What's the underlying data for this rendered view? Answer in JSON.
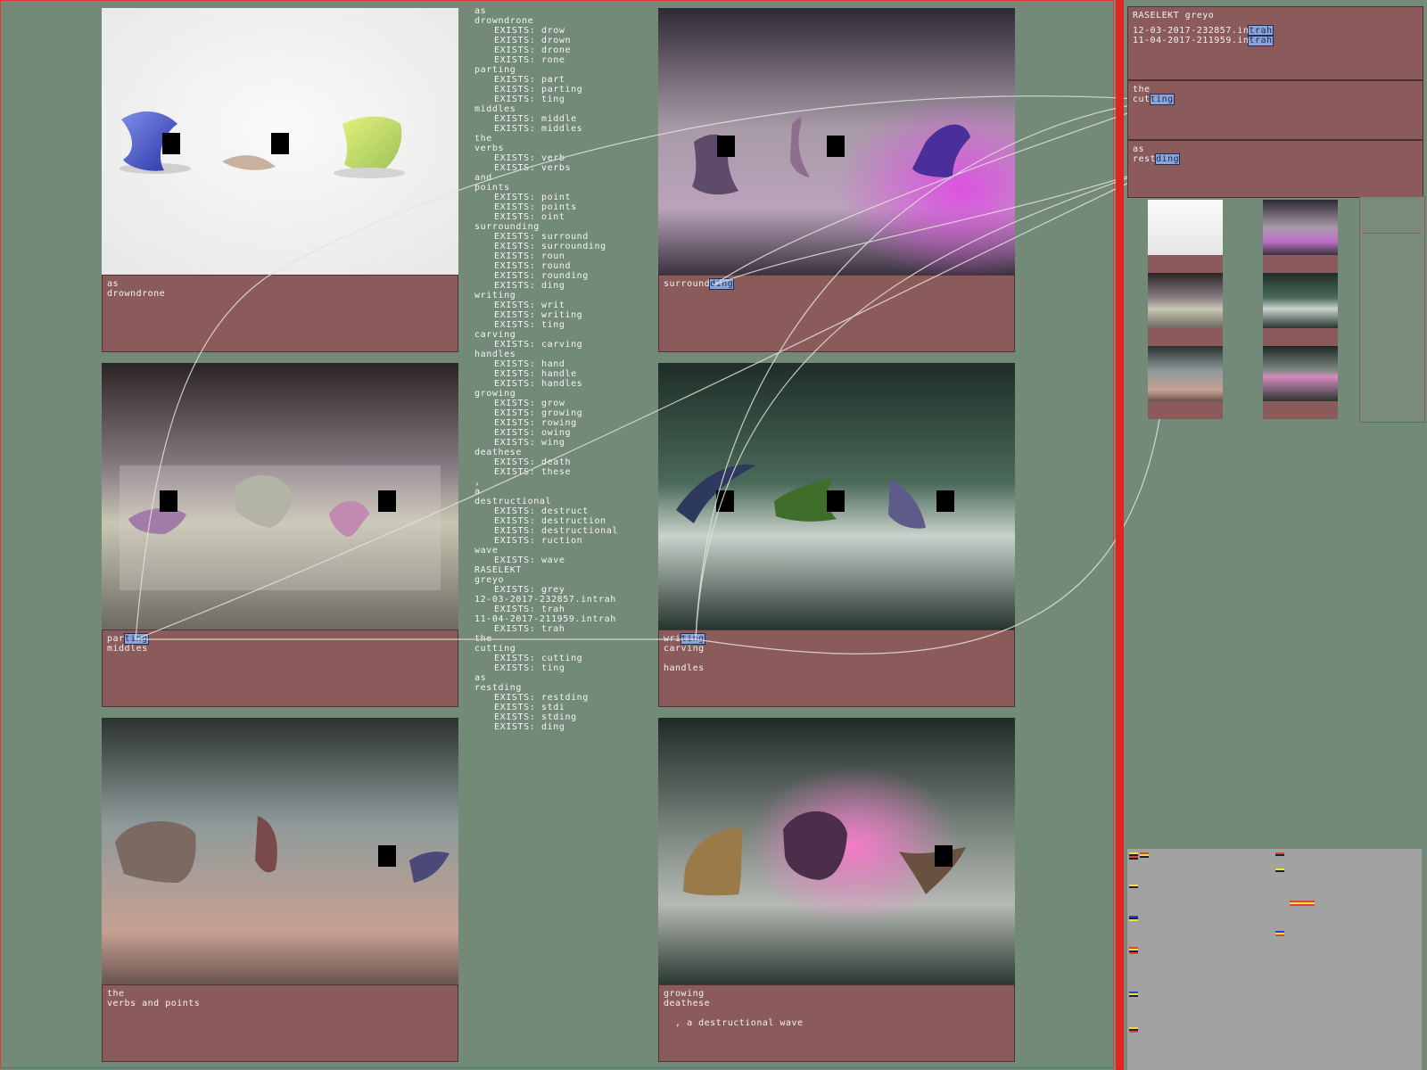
{
  "tiles": [
    {
      "caption": [
        "as",
        "drowndrone"
      ]
    },
    {
      "caption_parts": [
        {
          "t": "surround",
          "h": false
        },
        {
          "t": "ding",
          "h": true
        }
      ]
    },
    {
      "caption_parts_1": [
        {
          "t": "par",
          "h": false
        },
        {
          "t": "ting",
          "h": true
        }
      ],
      "caption_rest": [
        "middles"
      ]
    },
    {
      "caption_parts_1": [
        {
          "t": "wri",
          "h": false
        },
        {
          "t": "ting",
          "h": true
        }
      ],
      "caption_rest": [
        "carving",
        "",
        "handles"
      ]
    },
    {
      "caption": [
        "the",
        "verbs and points"
      ]
    },
    {
      "caption": [
        "growing",
        "deathese",
        "",
        "  , a destructional wave"
      ]
    }
  ],
  "wordlist": [
    {
      "t": "as",
      "i": false
    },
    {
      "t": "drowndrone",
      "i": false
    },
    {
      "t": "EXISTS: drow",
      "i": true
    },
    {
      "t": "EXISTS: drown",
      "i": true
    },
    {
      "t": "EXISTS: drone",
      "i": true
    },
    {
      "t": "EXISTS: rone",
      "i": true
    },
    {
      "t": "parting",
      "i": false
    },
    {
      "t": "EXISTS: part",
      "i": true
    },
    {
      "t": "EXISTS: parting",
      "i": true
    },
    {
      "t": "EXISTS: ting",
      "i": true
    },
    {
      "t": "middles",
      "i": false
    },
    {
      "t": "EXISTS: middle",
      "i": true
    },
    {
      "t": "EXISTS: middles",
      "i": true
    },
    {
      "t": "the",
      "i": false
    },
    {
      "t": "verbs",
      "i": false
    },
    {
      "t": "EXISTS: verb",
      "i": true
    },
    {
      "t": "EXISTS: verbs",
      "i": true
    },
    {
      "t": "and",
      "i": false
    },
    {
      "t": "points",
      "i": false
    },
    {
      "t": "EXISTS: point",
      "i": true
    },
    {
      "t": "EXISTS: points",
      "i": true
    },
    {
      "t": "EXISTS: oint",
      "i": true
    },
    {
      "t": "surrounding",
      "i": false
    },
    {
      "t": "EXISTS: surround",
      "i": true
    },
    {
      "t": "EXISTS: surrounding",
      "i": true
    },
    {
      "t": "EXISTS: roun",
      "i": true
    },
    {
      "t": "EXISTS: round",
      "i": true
    },
    {
      "t": "EXISTS: rounding",
      "i": true
    },
    {
      "t": "EXISTS: ding",
      "i": true
    },
    {
      "t": "writing",
      "i": false
    },
    {
      "t": "EXISTS: writ",
      "i": true
    },
    {
      "t": "EXISTS: writing",
      "i": true
    },
    {
      "t": "EXISTS: ting",
      "i": true
    },
    {
      "t": "carving",
      "i": false
    },
    {
      "t": "EXISTS: carving",
      "i": true
    },
    {
      "t": "handles",
      "i": false
    },
    {
      "t": "EXISTS: hand",
      "i": true
    },
    {
      "t": "EXISTS: handle",
      "i": true
    },
    {
      "t": "EXISTS: handles",
      "i": true
    },
    {
      "t": "growing",
      "i": false
    },
    {
      "t": "EXISTS: grow",
      "i": true
    },
    {
      "t": "EXISTS: growing",
      "i": true
    },
    {
      "t": "EXISTS: rowing",
      "i": true
    },
    {
      "t": "EXISTS: owing",
      "i": true
    },
    {
      "t": "EXISTS: wing",
      "i": true
    },
    {
      "t": "deathese",
      "i": false
    },
    {
      "t": "EXISTS: death",
      "i": true
    },
    {
      "t": "EXISTS: these",
      "i": true
    },
    {
      "t": ",",
      "i": false
    },
    {
      "t": "a",
      "i": false
    },
    {
      "t": "destructional",
      "i": false
    },
    {
      "t": "EXISTS: destruct",
      "i": true
    },
    {
      "t": "EXISTS: destruction",
      "i": true
    },
    {
      "t": "EXISTS: destructional",
      "i": true
    },
    {
      "t": "EXISTS: ruction",
      "i": true
    },
    {
      "t": "wave",
      "i": false
    },
    {
      "t": "EXISTS: wave",
      "i": true
    },
    {
      "t": "RASELEKT",
      "i": false
    },
    {
      "t": "greyo",
      "i": false
    },
    {
      "t": "EXISTS: grey",
      "i": true
    },
    {
      "t": "12-03-2017-232857.intrah",
      "i": false
    },
    {
      "t": "EXISTS: trah",
      "i": true
    },
    {
      "t": "11-04-2017-211959.intrah",
      "i": false
    },
    {
      "t": "EXISTS: trah",
      "i": true
    },
    {
      "t": "the",
      "i": false
    },
    {
      "t": "cutting",
      "i": false
    },
    {
      "t": "EXISTS: cutting",
      "i": true
    },
    {
      "t": "EXISTS: ting",
      "i": true
    },
    {
      "t": "as",
      "i": false
    },
    {
      "t": "restding",
      "i": false
    },
    {
      "t": "EXISTS: restding",
      "i": true
    },
    {
      "t": "EXISTS: stdi",
      "i": true
    },
    {
      "t": "EXISTS: stding",
      "i": true
    },
    {
      "t": "EXISTS: ding",
      "i": true
    }
  ],
  "right_panel": {
    "title": "RASELEKT greyo",
    "files": [
      {
        "name": "12-03-2017-232857.in",
        "hl": "trah"
      },
      {
        "name": "11-04-2017-211959.in",
        "hl": "trah"
      }
    ],
    "cut_box": {
      "line1": "the",
      "line2_plain": "cut",
      "line2_hl": "ting"
    },
    "rest_box": {
      "line1": "as",
      "line2_plain": "rest",
      "line2_hl": "ding"
    }
  },
  "colors": {
    "background": "#738a79",
    "caption": "#8b5b5b",
    "frame": "#e53935",
    "highlight": "#8fa4d6"
  }
}
